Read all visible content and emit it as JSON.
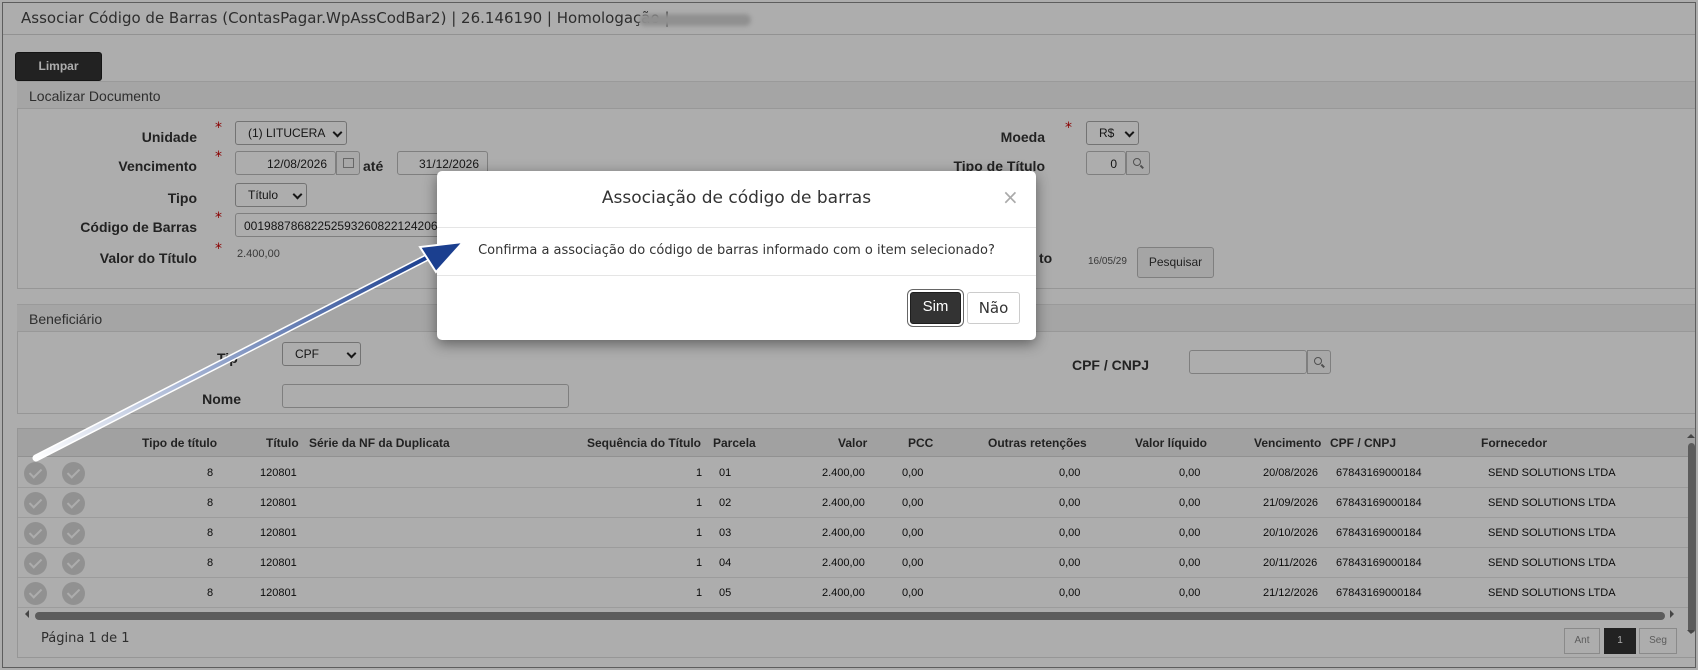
{
  "window": {
    "title": "Associar Código de Barras (ContasPagar.WpAssCodBar2) | 26.146190 | Homologação |"
  },
  "toolbar": {
    "limpar_label": "Limpar"
  },
  "localizar": {
    "section_title": "Localizar Documento",
    "unidade_label": "Unidade",
    "unidade_value": "(1) LITUCERA",
    "vencimento_label": "Vencimento",
    "vencimento_de": "12/08/2026",
    "ate_label": "até",
    "vencimento_ate": "31/12/2026",
    "tipo_label": "Tipo",
    "tipo_value": "Título",
    "codigo_label": "Código de Barras",
    "codigo_value": "00198878682252593260822124206",
    "valor_label": "Valor do Título",
    "valor_value": "2.400,00",
    "moeda_label": "Moeda",
    "moeda_value": "R$",
    "tipo_titulo_label": "Tipo de Título",
    "tipo_titulo_value": "0",
    "vencimento_right_partial": "to",
    "vencimento_right_value": "16/05/29",
    "pesquisar_label": "Pesquisar"
  },
  "beneficiario": {
    "section_title": "Beneficiário",
    "tipo_label_partial": "Tip",
    "tipo_value": "CPF",
    "nome_label": "Nome",
    "nome_value": "",
    "cpf_label": "CPF / CNPJ",
    "cpf_value": ""
  },
  "grid": {
    "headers": [
      "Tipo de título",
      "Título",
      "Série da NF da Duplicata",
      "Sequência do Título",
      "Parcela",
      "Valor",
      "PCC",
      "Outras retenções",
      "Valor líquido",
      "Vencimento",
      "CPF / CNPJ",
      "Fornecedor"
    ],
    "rows": [
      {
        "tipo": "8",
        "titulo": "120801",
        "serie": "",
        "sequencia": "1",
        "parcela": "01",
        "valor": "2.400,00",
        "pcc": "0,00",
        "outras": "0,00",
        "liquido": "0,00",
        "vencimento": "20/08/2026",
        "cpf": "67843169000184",
        "fornecedor": "SEND SOLUTIONS LTDA"
      },
      {
        "tipo": "8",
        "titulo": "120801",
        "serie": "",
        "sequencia": "1",
        "parcela": "02",
        "valor": "2.400,00",
        "pcc": "0,00",
        "outras": "0,00",
        "liquido": "0,00",
        "vencimento": "21/09/2026",
        "cpf": "67843169000184",
        "fornecedor": "SEND SOLUTIONS LTDA"
      },
      {
        "tipo": "8",
        "titulo": "120801",
        "serie": "",
        "sequencia": "1",
        "parcela": "03",
        "valor": "2.400,00",
        "pcc": "0,00",
        "outras": "0,00",
        "liquido": "0,00",
        "vencimento": "20/10/2026",
        "cpf": "67843169000184",
        "fornecedor": "SEND SOLUTIONS LTDA"
      },
      {
        "tipo": "8",
        "titulo": "120801",
        "serie": "",
        "sequencia": "1",
        "parcela": "04",
        "valor": "2.400,00",
        "pcc": "0,00",
        "outras": "0,00",
        "liquido": "0,00",
        "vencimento": "20/11/2026",
        "cpf": "67843169000184",
        "fornecedor": "SEND SOLUTIONS LTDA"
      },
      {
        "tipo": "8",
        "titulo": "120801",
        "serie": "",
        "sequencia": "1",
        "parcela": "05",
        "valor": "2.400,00",
        "pcc": "0,00",
        "outras": "0,00",
        "liquido": "0,00",
        "vencimento": "21/12/2026",
        "cpf": "67843169000184",
        "fornecedor": "SEND SOLUTIONS LTDA"
      }
    ]
  },
  "pager": {
    "info": "Página 1 de 1",
    "prev_label": "Ant",
    "current_page": "1",
    "next_label": "Seg"
  },
  "modal": {
    "title": "Associação de código de barras",
    "close_glyph": "×",
    "message": "Confirma a associação do código de barras informado com o item selecionado?",
    "yes_label": "Sim",
    "no_label": "Não"
  },
  "annotation": {
    "arrow_color": "#1b3f8f"
  }
}
